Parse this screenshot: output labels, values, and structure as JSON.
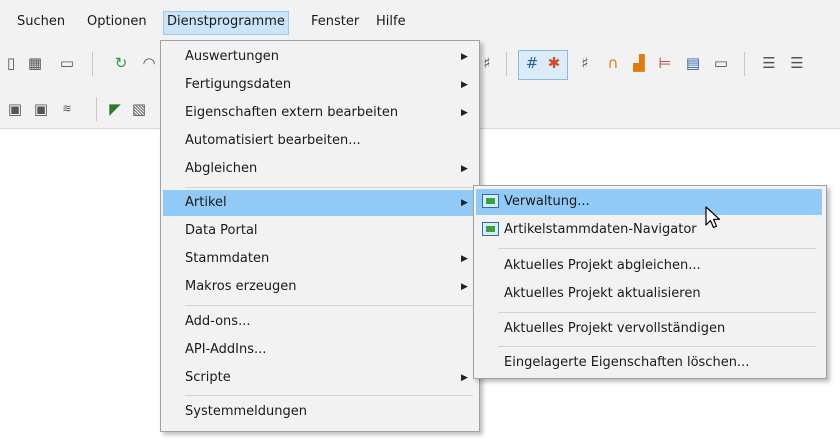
{
  "menubar": {
    "items": [
      "Suchen",
      "Optionen",
      "Dienstprogramme",
      "Fenster",
      "Hilfe"
    ],
    "active": "Dienstprogramme"
  },
  "dienstprogramme_menu": {
    "items": [
      "Auswertungen",
      "Fertigungsdaten",
      "Eigenschaften extern bearbeiten",
      "Automatisiert bearbeiten...",
      "Abgleichen",
      "Artikel",
      "Data Portal",
      "Stammdaten",
      "Makros erzeugen",
      "Add-ons...",
      "API-AddIns...",
      "Scripte",
      "Systemmeldungen"
    ],
    "highlighted": "Artikel"
  },
  "artikel_submenu": {
    "items": [
      "Verwaltung...",
      "Artikelstammdaten-Navigator",
      "Aktuelles Projekt abgleichen...",
      "Aktuelles Projekt aktualisieren",
      "Aktuelles Projekt vervollständigen",
      "Eingelagerte Eigenschaften löschen..."
    ],
    "highlighted": "Verwaltung..."
  },
  "icons": {
    "submenu_arrow": "triangle-right-icon",
    "cart": "shopping-cart-icon",
    "cursor": "mouse-pointer-icon"
  },
  "colors": {
    "highlight": "#91c9f7",
    "menu_bg": "#f2f2f2",
    "active_menubar": "#cce4f7"
  }
}
